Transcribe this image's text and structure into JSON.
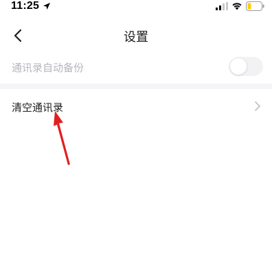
{
  "status_bar": {
    "time": "11:25"
  },
  "nav": {
    "title": "设置"
  },
  "settings": {
    "auto_backup_label": "通讯录自动备份",
    "auto_backup_enabled": false,
    "clear_contacts_label": "清空通讯录"
  },
  "colors": {
    "annotation_arrow": "#e02020",
    "disabled_text": "#b5b6bb",
    "divider": "#f5f5f7"
  },
  "icons": {
    "back": "chevron-left-icon",
    "row_chevron": "chevron-right-icon",
    "location": "location-arrow-icon",
    "signal": "cellular-signal-icon",
    "wifi": "wifi-icon",
    "battery": "battery-low-icon"
  }
}
